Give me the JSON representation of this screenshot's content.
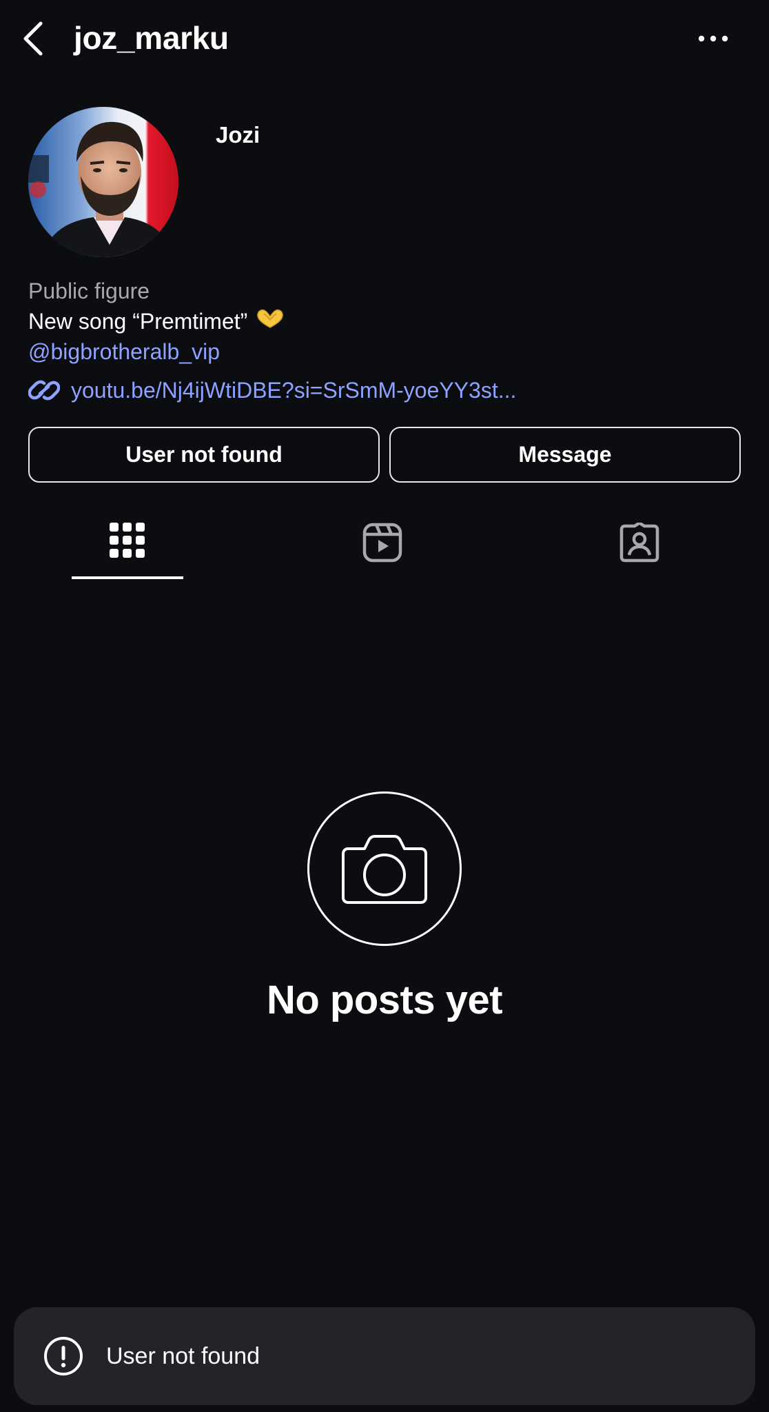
{
  "header": {
    "username": "joz_marku",
    "back_icon": "chevron-left-icon",
    "more_icon": "more-horizontal-icon"
  },
  "profile": {
    "display_name": "Jozi",
    "category": "Public figure",
    "bio": "New song “Premtimet”",
    "bio_emoji": "🫶",
    "mention": "@bigbrotheralb_vip",
    "link": "youtu.be/Nj4ijWtiDBE?si=SrSmM-yoeYY3st..."
  },
  "actions": {
    "primary_label": "User not found",
    "message_label": "Message"
  },
  "tabs": [
    {
      "name": "grid",
      "icon": "grid-icon",
      "active": true
    },
    {
      "name": "reels",
      "icon": "reels-icon",
      "active": false
    },
    {
      "name": "tagged",
      "icon": "tagged-icon",
      "active": false
    }
  ],
  "empty_state": {
    "title": "No posts yet",
    "icon": "camera-icon"
  },
  "toast": {
    "message": "User not found",
    "icon": "alert-icon"
  },
  "colors": {
    "background": "#0b0d10",
    "link": "#8ea2ff",
    "muted": "#a8a8ad",
    "toast_bg": "#232427"
  }
}
